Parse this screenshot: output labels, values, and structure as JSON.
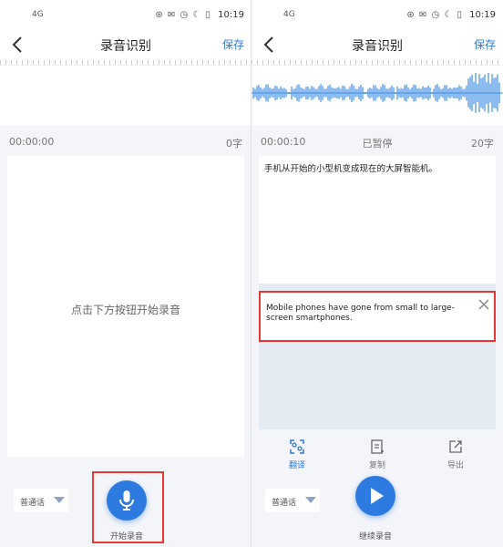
{
  "status": {
    "signal": "4G",
    "icons": "⊛ ✉ ◷ ☾ ▯",
    "time": "10:19"
  },
  "nav": {
    "title": "录音识别",
    "save": "保存"
  },
  "left": {
    "timer": "00:00:00",
    "word_count": "0字",
    "hint": "点击下方按钮开始录音",
    "language": "普通话",
    "record_label": "开始录音"
  },
  "right": {
    "timer": "00:00:10",
    "state": "已暂停",
    "word_count": "20字",
    "result_text": "手机从开始的小型机变成现在的大屏智能机。",
    "translation": "Mobile phones have gone from small to large-screen smartphones.",
    "tools": {
      "translate": "翻译",
      "copy": "复制",
      "export": "导出"
    },
    "language": "普通话",
    "continue_label": "继续录音"
  },
  "colors": {
    "accent": "#2d7be0",
    "highlight": "#e53935",
    "waveform": "#3f8ee6"
  }
}
